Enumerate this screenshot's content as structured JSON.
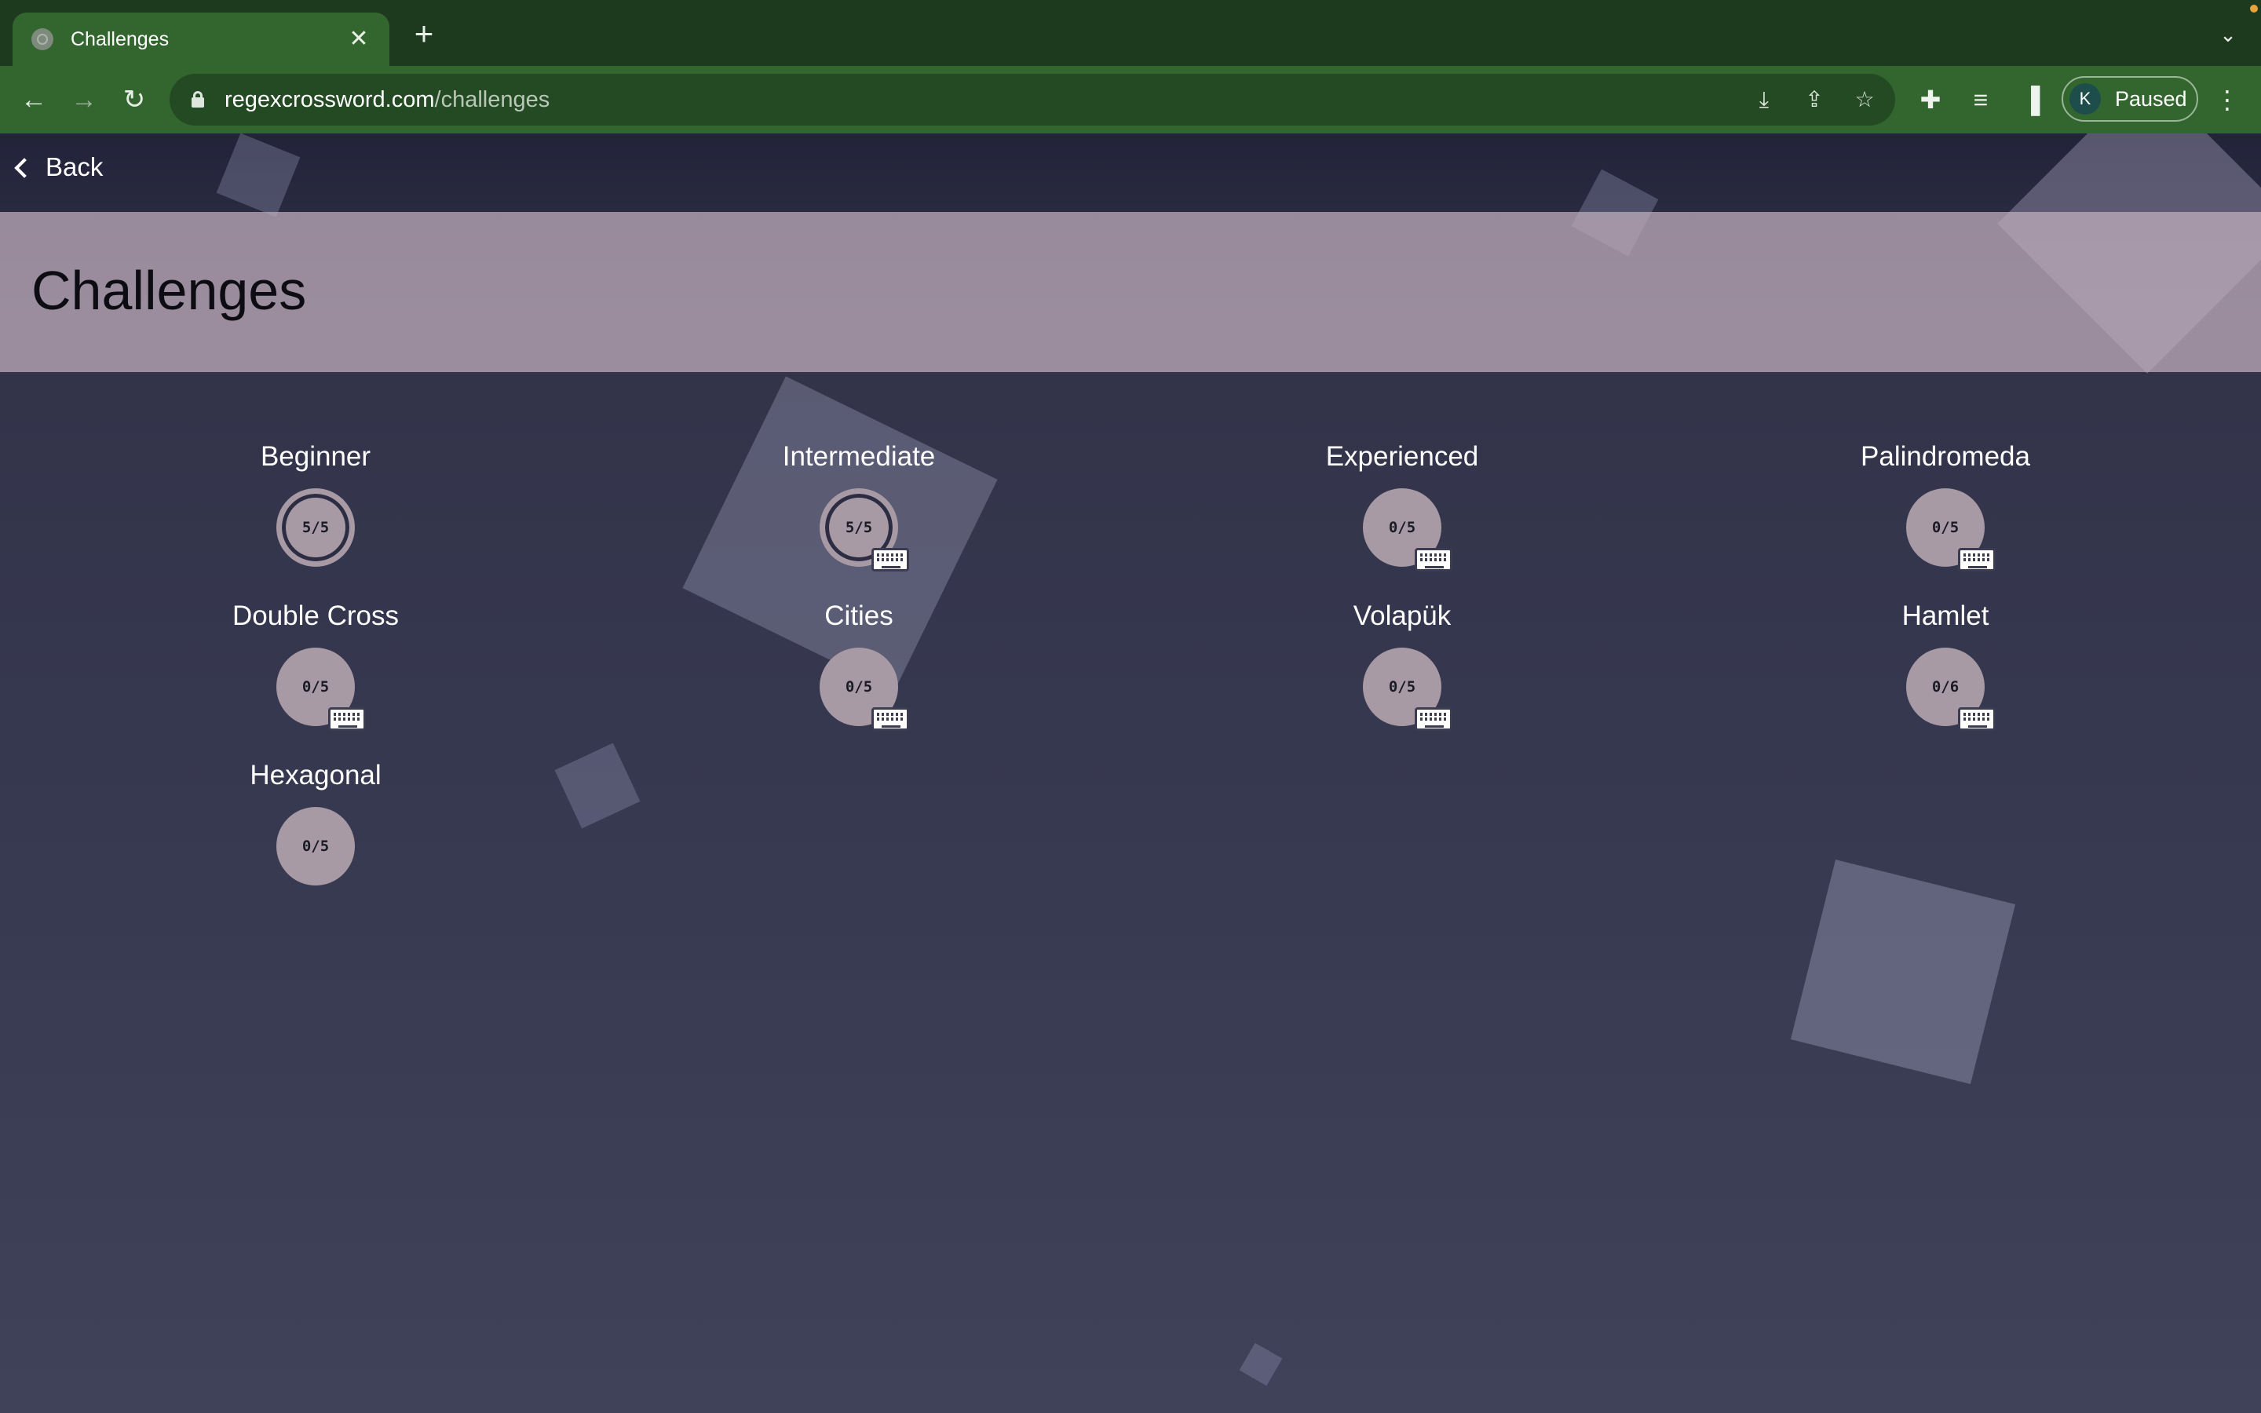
{
  "browser": {
    "tab_title": "Challenges",
    "url_host": "regexcrossword.com",
    "url_path": "/challenges",
    "profile_initial": "K",
    "profile_status": "Paused"
  },
  "page": {
    "back_label": "Back",
    "title": "Challenges"
  },
  "challenges": [
    {
      "name": "Beginner",
      "progress": "5/5",
      "completed": true,
      "keyboard": false
    },
    {
      "name": "Intermediate",
      "progress": "5/5",
      "completed": true,
      "keyboard": true
    },
    {
      "name": "Experienced",
      "progress": "0/5",
      "completed": false,
      "keyboard": true
    },
    {
      "name": "Palindromeda",
      "progress": "0/5",
      "completed": false,
      "keyboard": true
    },
    {
      "name": "Double Cross",
      "progress": "0/5",
      "completed": false,
      "keyboard": true
    },
    {
      "name": "Cities",
      "progress": "0/5",
      "completed": false,
      "keyboard": true
    },
    {
      "name": "Volapük",
      "progress": "0/5",
      "completed": false,
      "keyboard": true
    },
    {
      "name": "Hamlet",
      "progress": "0/6",
      "completed": false,
      "keyboard": true
    },
    {
      "name": "Hexagonal",
      "progress": "0/5",
      "completed": false,
      "keyboard": false
    }
  ],
  "colors": {
    "browser_frame": "#1e3a1e",
    "browser_toolbar": "#33662f",
    "page_background": "#383a52",
    "banner": "#c4b0be",
    "badge": "#a79aa5"
  }
}
